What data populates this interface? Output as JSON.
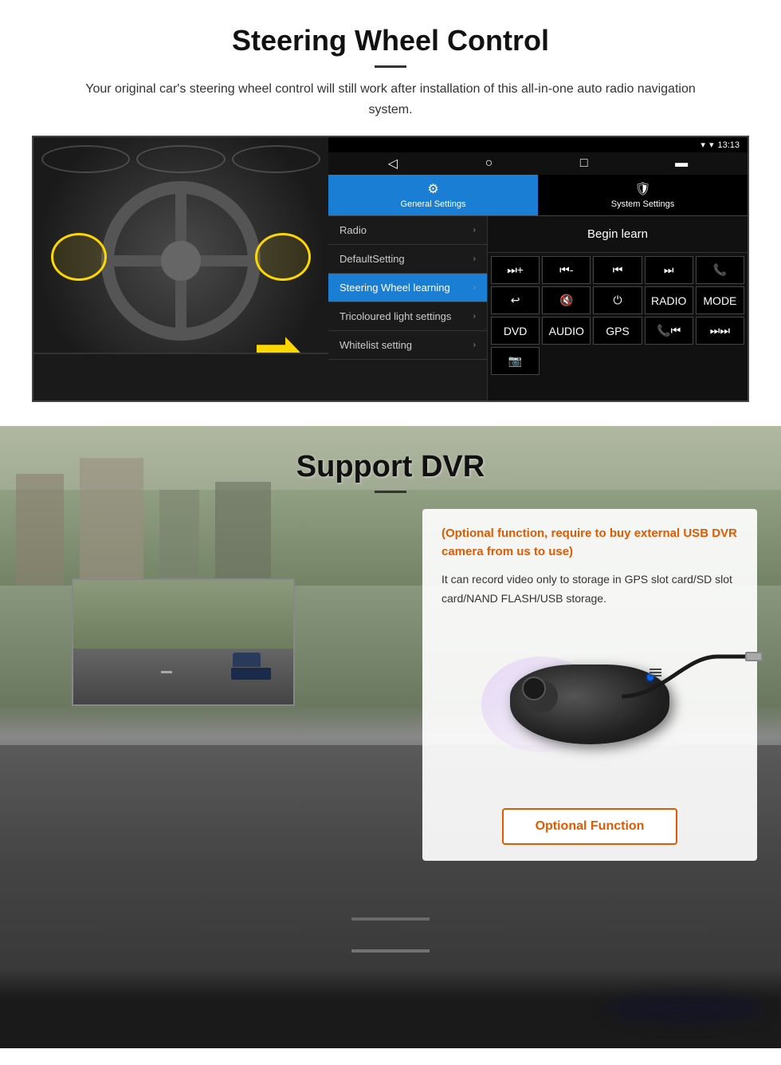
{
  "steering_section": {
    "title": "Steering Wheel Control",
    "description": "Your original car's steering wheel control will still work after installation of this all-in-one auto radio navigation system.",
    "android_ui": {
      "status_time": "13:13",
      "tabs": [
        {
          "label": "General Settings",
          "active": true
        },
        {
          "label": "System Settings",
          "active": false
        }
      ],
      "menu_items": [
        {
          "label": "Radio",
          "active": false
        },
        {
          "label": "DefaultSetting",
          "active": false
        },
        {
          "label": "Steering Wheel learning",
          "active": true
        },
        {
          "label": "Tricoloured light settings",
          "active": false
        },
        {
          "label": "Whitelist setting",
          "active": false
        }
      ],
      "begin_learn_label": "Begin learn",
      "control_buttons": [
        {
          "icon": "⏭+",
          "label": "vol+"
        },
        {
          "icon": "⏮-",
          "label": "vol-"
        },
        {
          "icon": "⏮⏮",
          "label": "prev"
        },
        {
          "icon": "⏭⏭",
          "label": "next"
        },
        {
          "icon": "📞",
          "label": "call"
        },
        {
          "icon": "↩",
          "label": "back"
        },
        {
          "icon": "🔇",
          "label": "mute"
        },
        {
          "icon": "⏻",
          "label": "power"
        },
        {
          "icon": "RADIO",
          "label": "radio"
        },
        {
          "icon": "MODE",
          "label": "mode"
        },
        {
          "icon": "DVD",
          "label": "dvd"
        },
        {
          "icon": "AUDIO",
          "label": "audio"
        },
        {
          "icon": "GPS",
          "label": "gps"
        },
        {
          "icon": "📞⏮",
          "label": "tel-prev"
        },
        {
          "icon": "⏭⏭",
          "label": "skip"
        },
        {
          "icon": "📷",
          "label": "camera"
        }
      ]
    }
  },
  "dvr_section": {
    "title": "Support DVR",
    "optional_text": "(Optional function, require to buy external USB DVR camera from us to use)",
    "description": "It can record video only to storage in GPS slot card/SD slot card/NAND FLASH/USB storage.",
    "optional_button_label": "Optional Function"
  }
}
